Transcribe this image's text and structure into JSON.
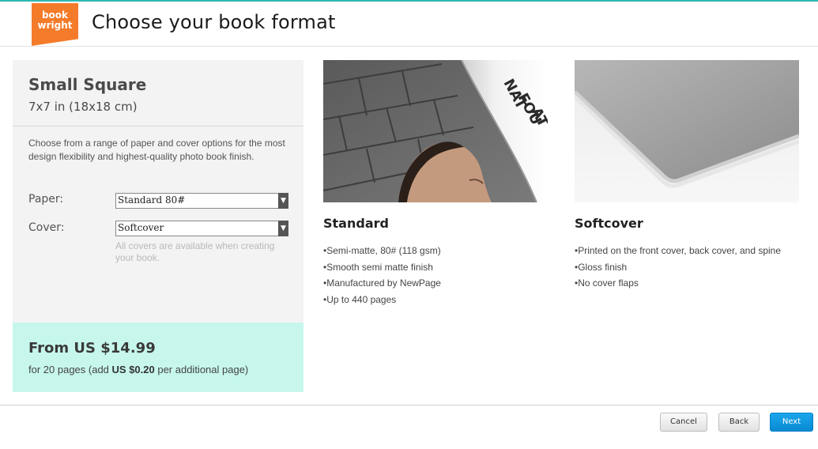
{
  "header": {
    "logo_line1": "book",
    "logo_line2": "wright",
    "title": "Choose your book format"
  },
  "format": {
    "name": "Small Square",
    "size": "7x7 in (18x18 cm)",
    "description": "Choose from a range of paper and cover options for the most design flexibility and highest-quality photo book finish.",
    "paper_label": "Paper:",
    "paper_value": "Standard 80#",
    "cover_label": "Cover:",
    "cover_value": "Softcover",
    "cover_hint": "All covers are available when creating your book.",
    "price": "From US $14.99",
    "price_note_prefix": "for 20 pages (add ",
    "price_note_amount": "US $0.20",
    "price_note_suffix": " per additional page)"
  },
  "paper_card": {
    "title": "Standard",
    "bullets": [
      "Semi-matte, 80# (118 gsm)",
      "Smooth semi matte finish",
      "Manufactured by NewPage",
      "Up to 440 pages"
    ],
    "image_text": [
      "NAT",
      "FOU",
      "AT"
    ]
  },
  "cover_card": {
    "title": "Softcover",
    "bullets": [
      "Printed on the front cover, back cover, and spine",
      "Gloss finish",
      "No cover flaps"
    ]
  },
  "footer": {
    "cancel_label": "Cancel",
    "back_label": "Back",
    "next_label": "Next"
  },
  "colors": {
    "brand_orange": "#f47b2a",
    "price_box": "#c7f7ec",
    "primary_button": "#0a8ad3"
  }
}
